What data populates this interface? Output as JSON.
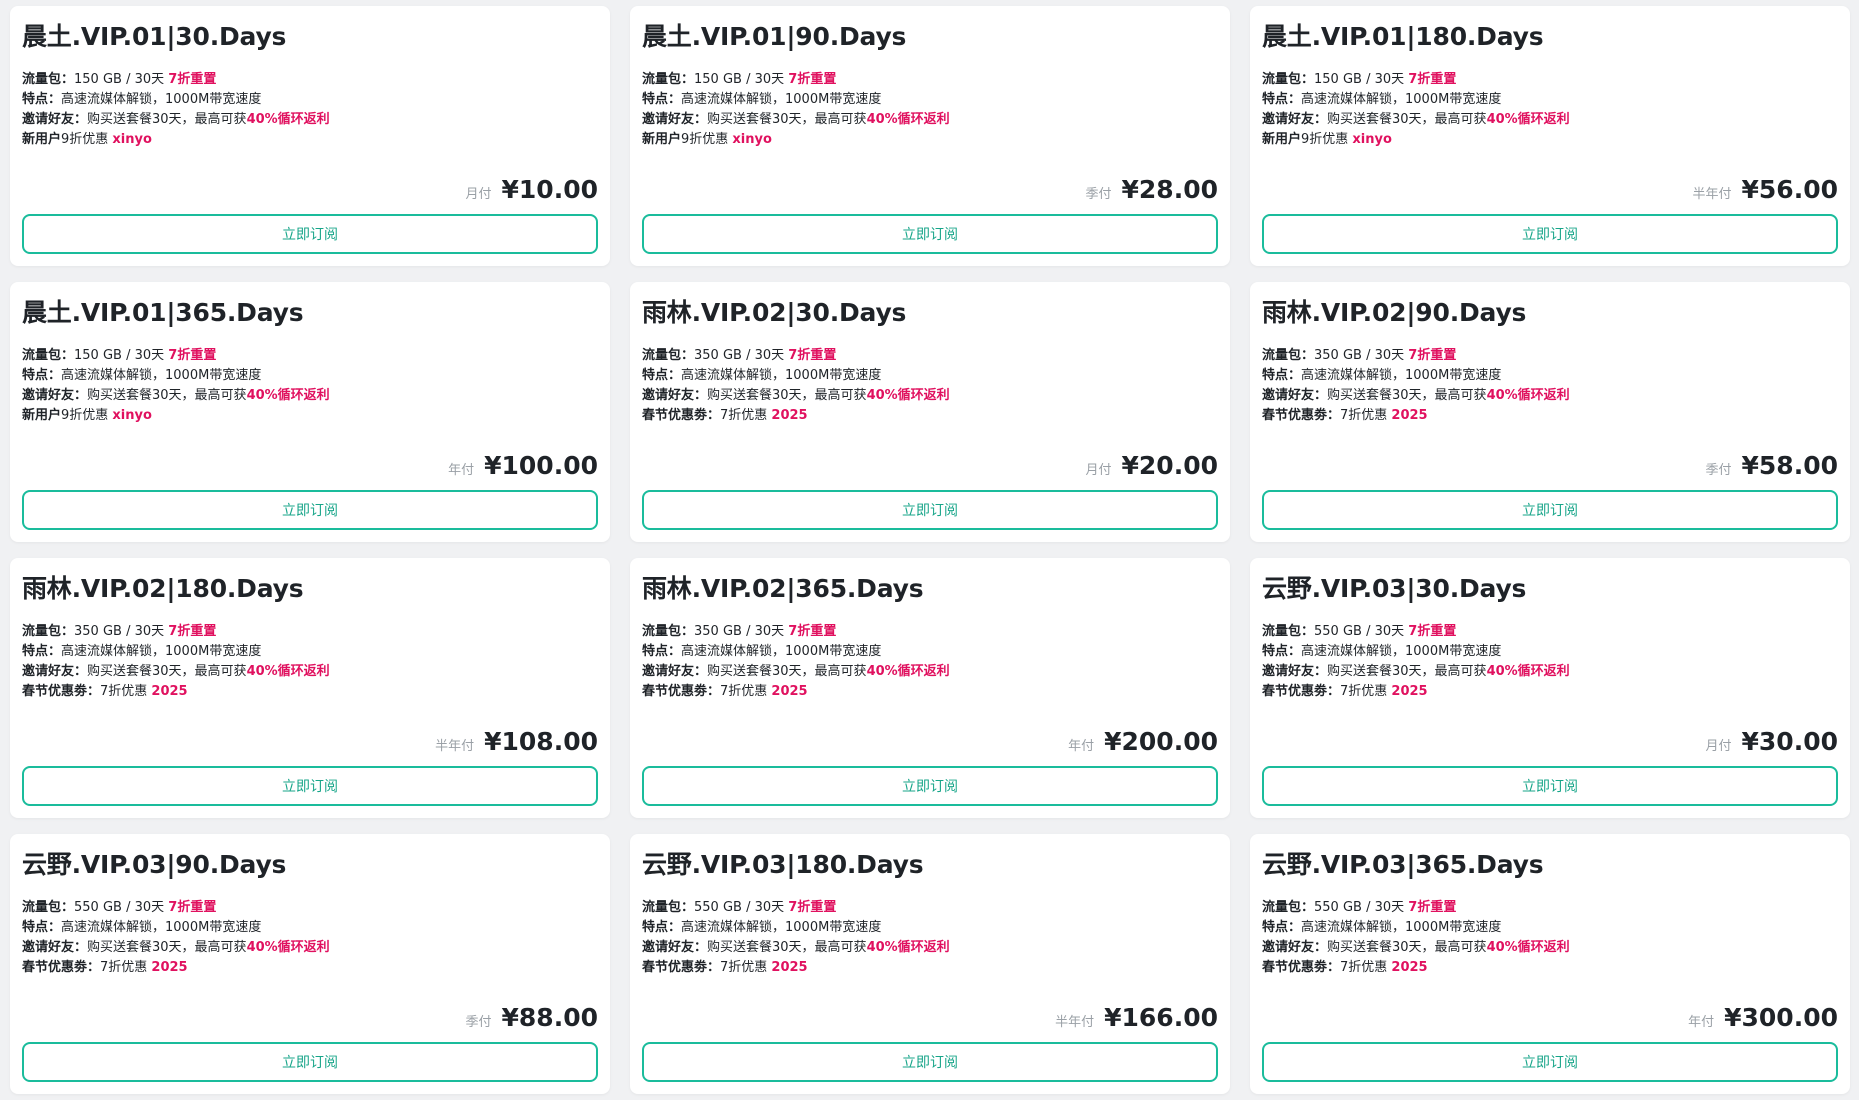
{
  "colors": {
    "accent": "#1abc9c",
    "highlight": "#e0115f",
    "background": "#f0f1f3",
    "card": "#ffffff"
  },
  "subscribe_label": "立即订阅",
  "plans": [
    {
      "title": "晨土.VIP.01|30.Days",
      "features": [
        {
          "key": "流量包：",
          "text": "150 GB / 30天 ",
          "hl": "7折重置"
        },
        {
          "key": "特点：",
          "text": "高速流媒体解锁，1000M带宽速度",
          "hl": ""
        },
        {
          "key": "邀请好友：",
          "text": "购买送套餐30天，最高可获",
          "hl": "40%循环返利"
        },
        {
          "key": "新用户",
          "text": "9折优惠 ",
          "hl": "xinyo"
        }
      ],
      "period": "月付",
      "price": "¥10.00"
    },
    {
      "title": "晨土.VIP.01|90.Days",
      "features": [
        {
          "key": "流量包：",
          "text": "150 GB / 30天 ",
          "hl": "7折重置"
        },
        {
          "key": "特点：",
          "text": "高速流媒体解锁，1000M带宽速度",
          "hl": ""
        },
        {
          "key": "邀请好友：",
          "text": "购买送套餐30天，最高可获",
          "hl": "40%循环返利"
        },
        {
          "key": "新用户",
          "text": "9折优惠 ",
          "hl": "xinyo"
        }
      ],
      "period": "季付",
      "price": "¥28.00"
    },
    {
      "title": "晨土.VIP.01|180.Days",
      "features": [
        {
          "key": "流量包：",
          "text": "150 GB / 30天 ",
          "hl": "7折重置"
        },
        {
          "key": "特点：",
          "text": "高速流媒体解锁，1000M带宽速度",
          "hl": ""
        },
        {
          "key": "邀请好友：",
          "text": "购买送套餐30天，最高可获",
          "hl": "40%循环返利"
        },
        {
          "key": "新用户",
          "text": "9折优惠 ",
          "hl": "xinyo"
        }
      ],
      "period": "半年付",
      "price": "¥56.00"
    },
    {
      "title": "晨土.VIP.01|365.Days",
      "features": [
        {
          "key": "流量包：",
          "text": "150 GB / 30天 ",
          "hl": "7折重置"
        },
        {
          "key": "特点：",
          "text": "高速流媒体解锁，1000M带宽速度",
          "hl": ""
        },
        {
          "key": "邀请好友：",
          "text": "购买送套餐30天，最高可获",
          "hl": "40%循环返利"
        },
        {
          "key": "新用户",
          "text": "9折优惠 ",
          "hl": "xinyo"
        }
      ],
      "period": "年付",
      "price": "¥100.00"
    },
    {
      "title": "雨林.VIP.02|30.Days",
      "features": [
        {
          "key": "流量包：",
          "text": "350 GB / 30天 ",
          "hl": "7折重置"
        },
        {
          "key": "特点：",
          "text": "高速流媒体解锁，1000M带宽速度",
          "hl": ""
        },
        {
          "key": "邀请好友：",
          "text": "购买送套餐30天，最高可获",
          "hl": "40%循环返利"
        },
        {
          "key": "春节优惠劵：",
          "text": "7折优惠 ",
          "hl": "2025"
        }
      ],
      "period": "月付",
      "price": "¥20.00"
    },
    {
      "title": "雨林.VIP.02|90.Days",
      "features": [
        {
          "key": "流量包：",
          "text": "350 GB / 30天 ",
          "hl": "7折重置"
        },
        {
          "key": "特点：",
          "text": "高速流媒体解锁，1000M带宽速度",
          "hl": ""
        },
        {
          "key": "邀请好友：",
          "text": "购买送套餐30天，最高可获",
          "hl": "40%循环返利"
        },
        {
          "key": "春节优惠劵：",
          "text": "7折优惠 ",
          "hl": "2025"
        }
      ],
      "period": "季付",
      "price": "¥58.00"
    },
    {
      "title": "雨林.VIP.02|180.Days",
      "features": [
        {
          "key": "流量包：",
          "text": "350 GB / 30天 ",
          "hl": "7折重置"
        },
        {
          "key": "特点：",
          "text": "高速流媒体解锁，1000M带宽速度",
          "hl": ""
        },
        {
          "key": "邀请好友：",
          "text": "购买送套餐30天，最高可获",
          "hl": "40%循环返利"
        },
        {
          "key": "春节优惠劵：",
          "text": "7折优惠 ",
          "hl": "2025"
        }
      ],
      "period": "半年付",
      "price": "¥108.00"
    },
    {
      "title": "雨林.VIP.02|365.Days",
      "features": [
        {
          "key": "流量包：",
          "text": "350 GB / 30天 ",
          "hl": "7折重置"
        },
        {
          "key": "特点：",
          "text": "高速流媒体解锁，1000M带宽速度",
          "hl": ""
        },
        {
          "key": "邀请好友：",
          "text": "购买送套餐30天，最高可获",
          "hl": "40%循环返利"
        },
        {
          "key": "春节优惠劵：",
          "text": "7折优惠 ",
          "hl": "2025"
        }
      ],
      "period": "年付",
      "price": "¥200.00"
    },
    {
      "title": "云野.VIP.03|30.Days",
      "features": [
        {
          "key": "流量包：",
          "text": "550 GB / 30天 ",
          "hl": "7折重置"
        },
        {
          "key": "特点：",
          "text": "高速流媒体解锁，1000M带宽速度",
          "hl": ""
        },
        {
          "key": "邀请好友：",
          "text": "购买送套餐30天，最高可获",
          "hl": "40%循环返利"
        },
        {
          "key": "春节优惠劵：",
          "text": "7折优惠 ",
          "hl": "2025"
        }
      ],
      "period": "月付",
      "price": "¥30.00"
    },
    {
      "title": "云野.VIP.03|90.Days",
      "features": [
        {
          "key": "流量包：",
          "text": "550 GB / 30天 ",
          "hl": "7折重置"
        },
        {
          "key": "特点：",
          "text": "高速流媒体解锁，1000M带宽速度",
          "hl": ""
        },
        {
          "key": "邀请好友：",
          "text": "购买送套餐30天，最高可获",
          "hl": "40%循环返利"
        },
        {
          "key": "春节优惠劵：",
          "text": "7折优惠 ",
          "hl": "2025"
        }
      ],
      "period": "季付",
      "price": "¥88.00"
    },
    {
      "title": "云野.VIP.03|180.Days",
      "features": [
        {
          "key": "流量包：",
          "text": "550 GB / 30天 ",
          "hl": "7折重置"
        },
        {
          "key": "特点：",
          "text": "高速流媒体解锁，1000M带宽速度",
          "hl": ""
        },
        {
          "key": "邀请好友：",
          "text": "购买送套餐30天，最高可获",
          "hl": "40%循环返利"
        },
        {
          "key": "春节优惠劵：",
          "text": "7折优惠 ",
          "hl": "2025"
        }
      ],
      "period": "半年付",
      "price": "¥166.00"
    },
    {
      "title": "云野.VIP.03|365.Days",
      "features": [
        {
          "key": "流量包：",
          "text": "550 GB / 30天 ",
          "hl": "7折重置"
        },
        {
          "key": "特点：",
          "text": "高速流媒体解锁，1000M带宽速度",
          "hl": ""
        },
        {
          "key": "邀请好友：",
          "text": "购买送套餐30天，最高可获",
          "hl": "40%循环返利"
        },
        {
          "key": "春节优惠劵：",
          "text": "7折优惠 ",
          "hl": "2025"
        }
      ],
      "period": "年付",
      "price": "¥300.00"
    }
  ]
}
